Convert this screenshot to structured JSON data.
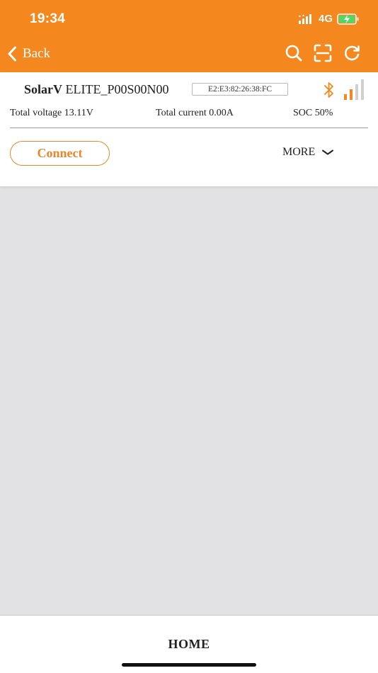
{
  "status_bar": {
    "time": "19:34",
    "network": "4G"
  },
  "nav": {
    "back_label": "Back",
    "actions": [
      "search-icon",
      "scan-icon",
      "refresh-icon"
    ]
  },
  "device": {
    "brand": "SolarV",
    "model": "ELITE_P00S00N00",
    "mac": "E2:E3:82:26:38:FC",
    "total_voltage": "Total voltage 13.11V",
    "total_current": "Total current 0.00A",
    "soc": "SOC 50%",
    "signal_bars_active": 2,
    "signal_bars_total": 4
  },
  "buttons": {
    "connect": "Connect",
    "more": "MORE"
  },
  "tabbar": {
    "home": "HOME"
  },
  "colors": {
    "accent": "#f5871f",
    "background": "#e2e2e4",
    "signal_inactive": "#d0d0d0"
  }
}
